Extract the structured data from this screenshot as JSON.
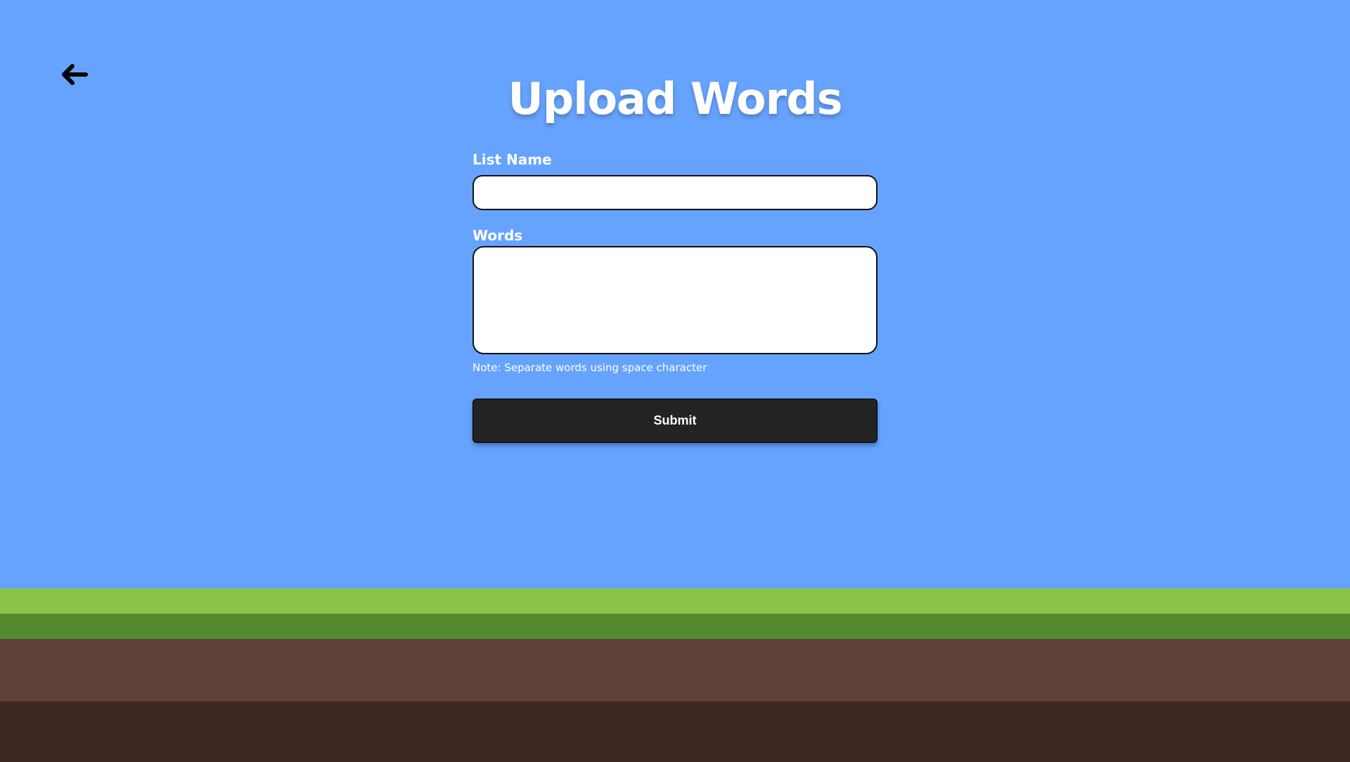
{
  "page": {
    "title": "Upload Words",
    "back_icon": "arrow-left-icon"
  },
  "form": {
    "list_name": {
      "label": "List Name",
      "value": "",
      "placeholder": ""
    },
    "words": {
      "label": "Words",
      "value": "",
      "placeholder": ""
    },
    "note": "Note: Separate words using space character",
    "submit_label": "Submit"
  },
  "colors": {
    "sky": "#66a3fe",
    "grass_light": "#8bc34a",
    "grass_dark": "#558b2f",
    "dirt_light": "#5d4037",
    "dirt_dark": "#3e2723",
    "button": "#232323",
    "text": "#ffffff"
  }
}
